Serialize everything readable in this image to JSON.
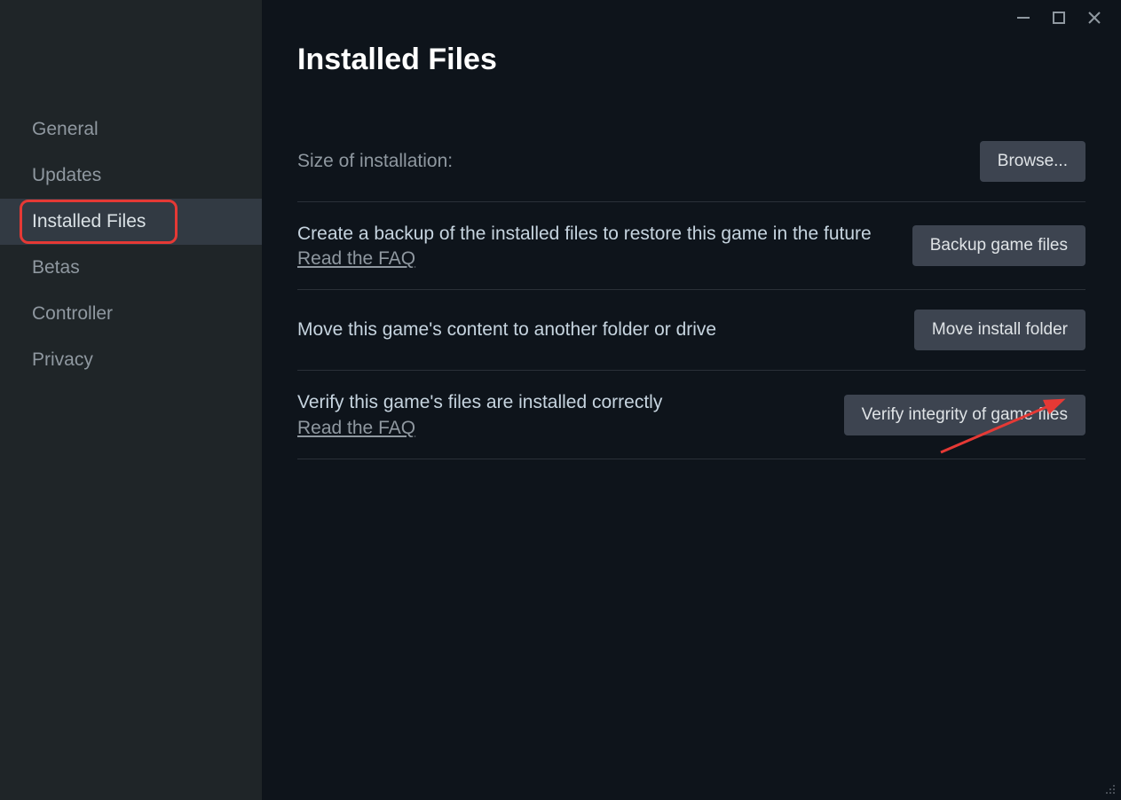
{
  "titlebar": {
    "minimize": "minimize",
    "maximize": "maximize",
    "close": "close"
  },
  "sidebar": {
    "items": [
      {
        "label": "General",
        "active": false
      },
      {
        "label": "Updates",
        "active": false
      },
      {
        "label": "Installed Files",
        "active": true
      },
      {
        "label": "Betas",
        "active": false
      },
      {
        "label": "Controller",
        "active": false
      },
      {
        "label": "Privacy",
        "active": false
      }
    ]
  },
  "content": {
    "title": "Installed Files",
    "size_row": {
      "label": "Size of installation:",
      "button": "Browse..."
    },
    "backup_row": {
      "desc": "Create a backup of the installed files to restore this game in the future",
      "faq": "Read the FAQ",
      "button": "Backup game files"
    },
    "move_row": {
      "desc": "Move this game's content to another folder or drive",
      "button": "Move install folder"
    },
    "verify_row": {
      "desc": "Verify this game's files are installed correctly",
      "faq": "Read the FAQ",
      "button": "Verify integrity of game files"
    }
  },
  "annotation": {
    "highlight_color": "#e53935",
    "arrow_color": "#e53935"
  }
}
